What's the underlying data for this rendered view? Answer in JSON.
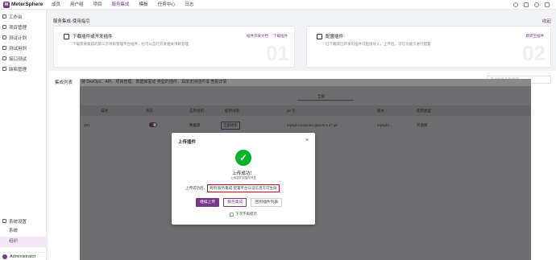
{
  "app": {
    "logo_mark": "M",
    "name": "MeterSphere"
  },
  "top_nav": {
    "items": [
      "成员",
      "用户组",
      "项目",
      "服务集成",
      "模板",
      "任务中心",
      "日志"
    ],
    "active_index": 3
  },
  "sidebar": {
    "items": [
      {
        "label": "工作台",
        "icon": "workbench-icon"
      },
      {
        "label": "项目管理",
        "icon": "project-icon"
      },
      {
        "label": "测试计划",
        "icon": "plan-icon"
      },
      {
        "label": "测试用例",
        "icon": "case-icon"
      },
      {
        "label": "接口测试",
        "icon": "api-icon"
      },
      {
        "label": "缺陷管理",
        "icon": "bug-icon"
      }
    ],
    "settings_group": "系统设置",
    "sub_items": [
      "系统",
      "组织"
    ],
    "active_sub": "组织",
    "user": "Administrator"
  },
  "guide": {
    "title": "服务集成-使用指引",
    "collapse_label": "收起",
    "cards": [
      {
        "title": "下载插件或开发插件",
        "desc": "下载需要集成的第三方项目管理平台插件，也可以自行开发相关项目管理",
        "links": [
          "插件开发文档",
          "下载插件"
        ],
        "num": "01"
      },
      {
        "title": "配置插件",
        "desc": "已下载或已开发的插件可直接导入，上传后，可在功能页进行配置",
        "links": [
          "跳转至插件"
        ],
        "num": "02"
      }
    ]
  },
  "list": {
    "title": "集成列表",
    "search_placeholder": "通过插件名称搜索",
    "banner": "持 DevOps、API、项目管理、数据库驱动 类型的插件，具体支持插件请 查看详情",
    "tab_all": "全部",
    "columns": [
      "",
      "描述",
      "状态",
      "应用组织",
      "使用场景",
      "jar 包",
      "版本",
      "使用类型"
    ],
    "row": {
      "id": "101",
      "desc": "-",
      "org": "数据库",
      "tag": "全部组织",
      "jar": "mysql-connector-java-5.1.47.jar",
      "version": "mysql-c...",
      "type": "开源版"
    }
  },
  "modal": {
    "title": "上传插件",
    "close": "×",
    "icon": "success-check-icon",
    "check_glyph": "✓",
    "success_title": "上传成功！",
    "success_sub": "上传插件到插件列表",
    "msg_prefix": "上传成功后，",
    "msg_highlight": "将到 服务集成 配置平台认证信息方可生效",
    "buttons": {
      "continue": "继续上传",
      "service": "服务集成",
      "back": "回到插件列表"
    },
    "checkbox_label": "下次不再提示"
  }
}
